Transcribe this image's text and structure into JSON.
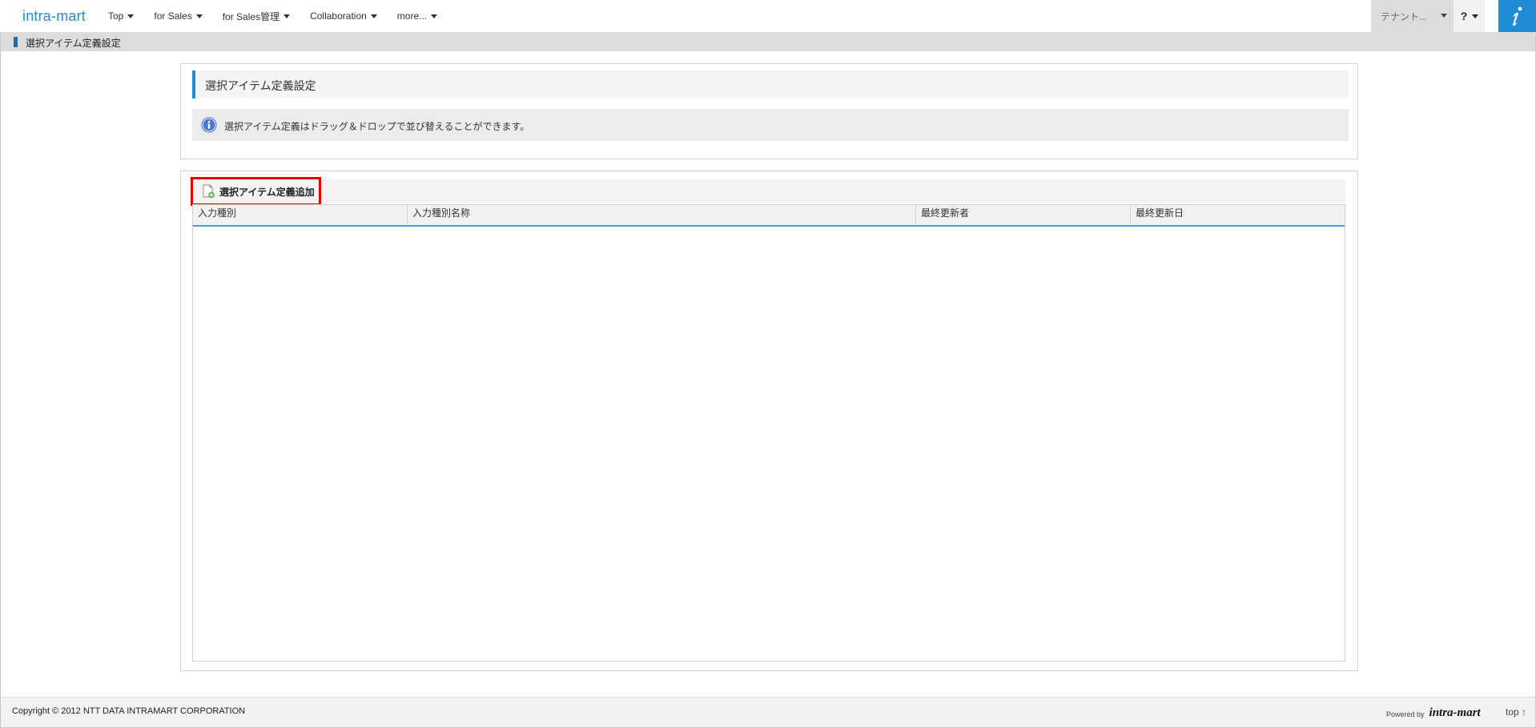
{
  "brand": "intra-mart",
  "nav": {
    "items": [
      {
        "label": "Top"
      },
      {
        "label": "for Sales"
      },
      {
        "label": "for Sales管理"
      },
      {
        "label": "Collaboration"
      },
      {
        "label": "more..."
      }
    ],
    "tenant_label": "テナント...",
    "help_label": "?"
  },
  "breadcrumb": {
    "label": "選択アイテム定義設定"
  },
  "page": {
    "title": "選択アイテム定義設定",
    "info_text": "選択アイテム定義はドラッグ＆ドロップで並び替えることができます。"
  },
  "toolbar": {
    "add_label": "選択アイテム定義追加"
  },
  "grid": {
    "columns": [
      "入力種別",
      "入力種別名称",
      "最終更新者",
      "最終更新日"
    ],
    "rows": []
  },
  "footer": {
    "copyright": "Copyright © 2012 NTT DATA INTRAMART CORPORATION",
    "powered_by": "Powered by",
    "powered_logo": "intra-mart",
    "top_link": "top ↑"
  }
}
